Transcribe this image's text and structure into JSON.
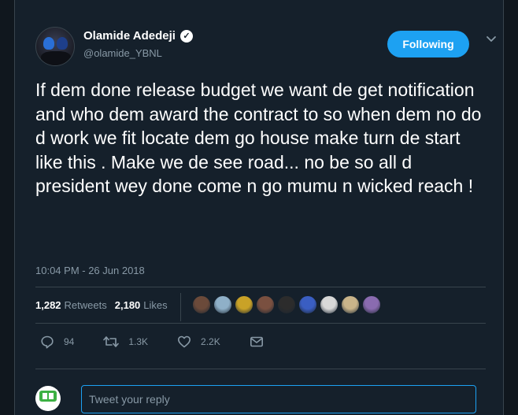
{
  "tweet": {
    "author": {
      "display_name": "Olamide Adedeji",
      "handle": "@olamide_YBNL",
      "verified_icon": "verified-badge-icon"
    },
    "follow_button_label": "Following",
    "text": "If dem done release budget we want de get notification and who dem award the contract to so when dem no do d work we fit locate dem go house make turn de start like this . Make we de see road... no be so all d president wey done come n go mumu n wicked reach !",
    "timestamp": "10:04 PM - 26 Jun 2018",
    "stats": {
      "retweets_count": "1,282",
      "retweets_label": "Retweets",
      "likes_count": "2,180",
      "likes_label": "Likes"
    },
    "liker_avatar_colors": [
      "#6b4a3a",
      "#8fb0c8",
      "#c9a227",
      "#7a5040",
      "#2c2c2c",
      "#3a5ec2",
      "#d8d8d8",
      "#c9b48a",
      "#8a6bb0"
    ],
    "actions": {
      "replies": "94",
      "retweets": "1.3K",
      "likes": "2.2K"
    }
  },
  "reply": {
    "placeholder": "Tweet your reply"
  },
  "colors": {
    "background": "#15202b",
    "accent": "#1da1f2",
    "secondary_text": "#8899a6"
  }
}
